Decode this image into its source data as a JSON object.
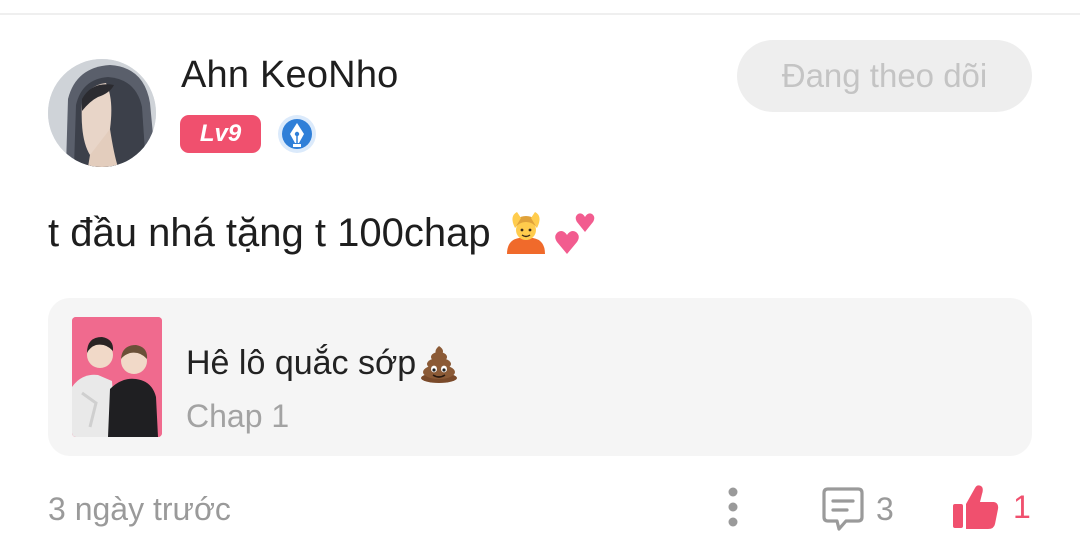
{
  "post": {
    "author": {
      "name": "Ahn KeoNho",
      "level": "Lv9",
      "avatar_icon": "avatar-photo",
      "badge_icon": "pen-nib-badge-icon"
    },
    "follow_button_label": "Đang theo dõi",
    "comment_text": "t đầu nhá tặng t 100chap",
    "comment_emojis": [
      "person-gesturing-ok-emoji",
      "two-hearts-emoji"
    ],
    "manga": {
      "title": "Hê lô quắc sớp",
      "title_emoji": "pile-of-poo-emoji",
      "chapter": "Chap 1"
    },
    "timestamp": "3 ngày trước",
    "reply_count": "3",
    "like_count": "1"
  },
  "colors": {
    "accent": "#f0506e",
    "muted_text": "#9a9a9a",
    "card_bg": "#f5f5f5",
    "follow_bg": "#eeeeee"
  }
}
